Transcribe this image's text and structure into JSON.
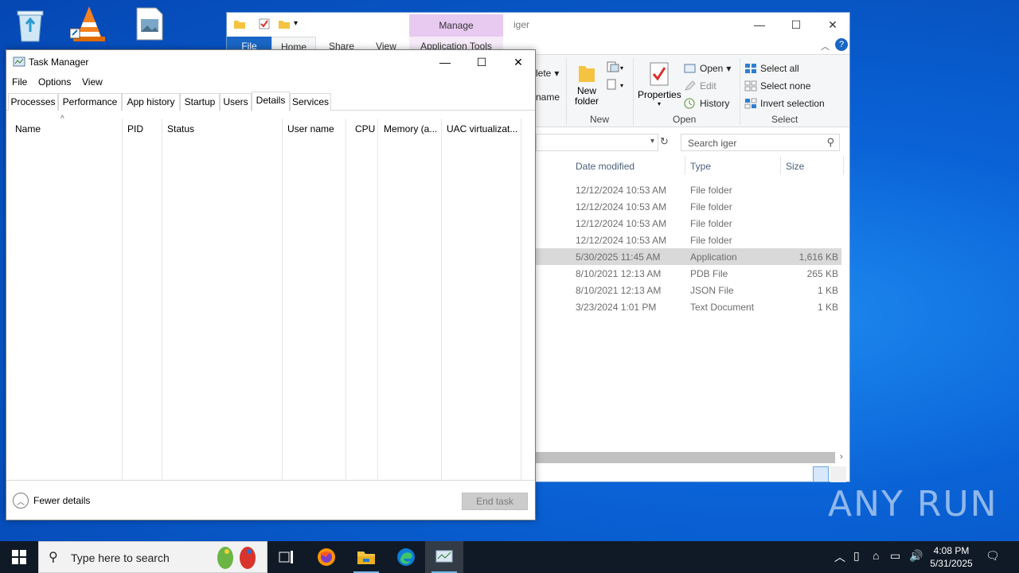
{
  "desktop": {
    "icons": [
      "recycle-bin",
      "vlc-media-player",
      "image-file"
    ]
  },
  "explorer": {
    "title": "iger",
    "context_tab_group": "Manage",
    "tabs": [
      "File",
      "Home",
      "Share",
      "View",
      "Application Tools"
    ],
    "ribbon": {
      "organize_partial": [
        "lete",
        "name"
      ],
      "new_group": {
        "new_folder": "New\nfolder",
        "label": "New"
      },
      "open_group": {
        "properties": "Properties",
        "open": "Open",
        "edit": "Edit",
        "history": "History",
        "label": "Open"
      },
      "select_group": {
        "select_all": "Select all",
        "select_none": "Select none",
        "invert_selection": "Invert selection",
        "label": "Select"
      }
    },
    "search_placeholder": "Search iger",
    "columns": [
      "Date modified",
      "Type",
      "Size"
    ],
    "rows": [
      {
        "date": "12/12/2024 10:53 AM",
        "type": "File folder",
        "size": ""
      },
      {
        "date": "12/12/2024 10:53 AM",
        "type": "File folder",
        "size": ""
      },
      {
        "date": "12/12/2024 10:53 AM",
        "type": "File folder",
        "size": ""
      },
      {
        "date": "12/12/2024 10:53 AM",
        "type": "File folder",
        "size": ""
      },
      {
        "date": "5/30/2025 11:45 AM",
        "type": "Application",
        "size": "1,616 KB"
      },
      {
        "date": "8/10/2021 12:13 AM",
        "type": "PDB File",
        "size": "265 KB"
      },
      {
        "date": "8/10/2021 12:13 AM",
        "type": "JSON File",
        "size": "1 KB"
      },
      {
        "date": "3/23/2024 1:01 PM",
        "type": "Text Document",
        "size": "1 KB"
      }
    ]
  },
  "taskmgr": {
    "title": "Task Manager",
    "menu": [
      "File",
      "Options",
      "View"
    ],
    "tabs": [
      "Processes",
      "Performance",
      "App history",
      "Startup",
      "Users",
      "Details",
      "Services"
    ],
    "active_tab": "Details",
    "columns": [
      "Name",
      "PID",
      "Status",
      "User name",
      "CPU",
      "Memory (a...",
      "UAC virtualizat..."
    ],
    "fewer_details": "Fewer details",
    "end_task": "End task"
  },
  "watermark": "ANY RUN",
  "taskbar": {
    "search_placeholder": "Type here to search",
    "time": "4:08 PM",
    "date": "5/31/2025"
  },
  "colors": {
    "accent": "#1966c4",
    "manage_tab": "#e8c9f0",
    "selected_row": "#d9d9d9",
    "taskbar": "#101a26"
  }
}
